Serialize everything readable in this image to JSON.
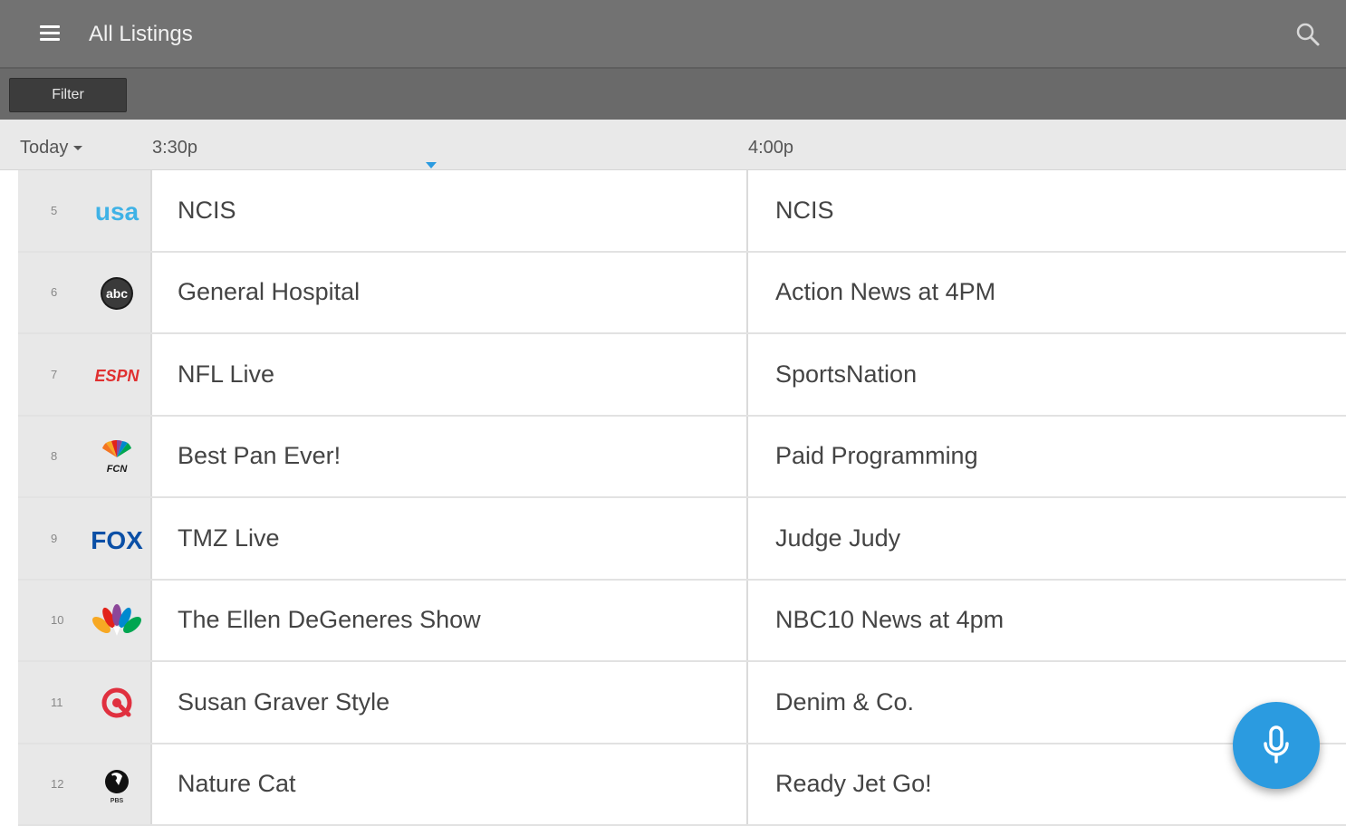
{
  "appbar": {
    "title": "All Listings",
    "menu_icon": "hamburger-menu-icon",
    "search_icon": "search-icon"
  },
  "subbar": {
    "filter_label": "Filter"
  },
  "timebar": {
    "day_label": "Today",
    "times": [
      "3:30p",
      "4:00p"
    ]
  },
  "listings": [
    {
      "channel": "5",
      "network": "usa",
      "logo_icon": "usa-network-logo",
      "now": "NCIS",
      "next": "NCIS"
    },
    {
      "channel": "6",
      "network": "abc",
      "logo_icon": "abc-logo",
      "now": "General Hospital",
      "next": "Action News at 4PM"
    },
    {
      "channel": "7",
      "network": "ESPN",
      "logo_icon": "espn-logo",
      "now": "NFL Live",
      "next": "SportsNation"
    },
    {
      "channel": "8",
      "network": "FCN",
      "logo_icon": "nbc-peacock-fcn-logo",
      "now": "Best Pan Ever!",
      "next": "Paid Programming"
    },
    {
      "channel": "9",
      "network": "FOX",
      "logo_icon": "fox-logo",
      "now": "TMZ Live",
      "next": "Judge Judy"
    },
    {
      "channel": "10",
      "network": "NBC",
      "logo_icon": "nbc-peacock-logo",
      "now": "The Ellen DeGeneres Show",
      "next": "NBC10 News at 4pm"
    },
    {
      "channel": "11",
      "network": "QVC",
      "logo_icon": "qvc-logo",
      "now": "Susan Graver Style",
      "next": "Denim & Co."
    },
    {
      "channel": "12",
      "network": "PBS",
      "logo_icon": "pbs-logo",
      "now": "Nature Cat",
      "next": "Ready Jet Go!"
    }
  ],
  "fab": {
    "icon": "microphone-icon"
  },
  "colors": {
    "appbar": "#727272",
    "accent": "#2b9be0"
  }
}
